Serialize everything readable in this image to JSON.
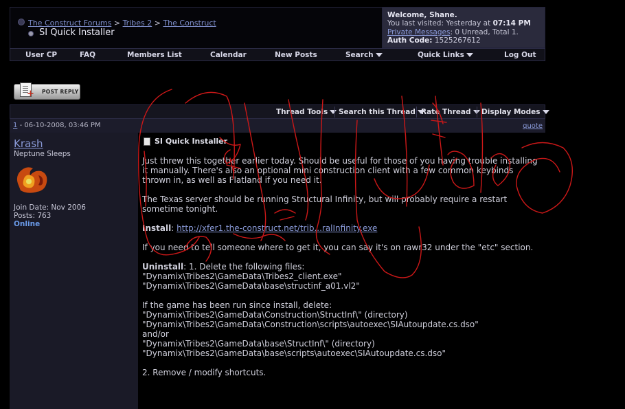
{
  "header": {
    "breadcrumb": [
      "The Construct Forums",
      "Tribes 2",
      "The Construct"
    ],
    "breadcrumb_sep": ">",
    "thread_title": "SI Quick Installer"
  },
  "welcome": {
    "greeting": "Welcome, Shane.",
    "last_visited_label": "You last visited: Yesterday at",
    "last_visited_time": "07:14 PM",
    "private_messages_link": "Private Messages",
    "private_messages_status": ": 0 Unread, Total 1.",
    "auth_code_label": "Auth Code:",
    "auth_code_value": "1525267612"
  },
  "nav": {
    "items": [
      {
        "label": "User CP",
        "dropdown": false
      },
      {
        "label": "FAQ",
        "dropdown": false
      },
      {
        "label": "Members List",
        "dropdown": false
      },
      {
        "label": "Calendar",
        "dropdown": false
      },
      {
        "label": "New Posts",
        "dropdown": false
      },
      {
        "label": "Search",
        "dropdown": true
      },
      {
        "label": "Quick Links",
        "dropdown": true
      },
      {
        "label": "Log Out",
        "dropdown": false
      }
    ]
  },
  "post_reply_label": "POST REPLY",
  "thread_tools": {
    "items": [
      {
        "label": "Thread Tools"
      },
      {
        "label": "Search this Thread"
      },
      {
        "label": "Rate Thread"
      },
      {
        "label": "Display Modes"
      }
    ]
  },
  "post": {
    "number": "1",
    "date": "- 06-10-2008, 03:46 PM",
    "quote_label": "quote",
    "author": {
      "name": "Krash",
      "title": "Neptune Sleeps",
      "join_date": "Join Date: Nov 2006",
      "posts": "Posts: 763",
      "status": "Online"
    },
    "title": "SI Quick Installer",
    "body": {
      "p1": "Just threw this together earlier today. Should be useful for those of you having trouble installing it manually. There's also an optional mini construction client with a few common keybinds thrown in, as well as Flatland if you need it.",
      "p2": "The Texas server should be running Structural Infinity, but will probably require a restart sometime tonight.",
      "install_label": "Install",
      "install_sep": ": ",
      "install_link": "http://xfer1.the-construct.net/trib...ralInfinity.exe",
      "p4": "If you need to tell someone where to get it, you can say it's on rawr32 under the \"etc\" section.",
      "uninstall_label": "Uninstall",
      "uninstall_step1": ": 1. Delete the following files:",
      "files": [
        "\"Dynamix\\Tribes2\\GameData\\Tribes2_client.exe\"",
        "\"Dynamix\\Tribes2\\GameData\\base\\structinf_a01.vl2\""
      ],
      "ran_label": "If the game has been run since install, delete:",
      "ran_files": [
        "\"Dynamix\\Tribes2\\GameData\\Construction\\StructInf\\\" (directory)",
        "\"Dynamix\\Tribes2\\GameData\\Construction\\scripts\\autoexec\\SIAutoupdate.cs.dso\"",
        "and/or",
        "\"Dynamix\\Tribes2\\GameData\\base\\StructInf\\\" (directory)",
        "\"Dynamix\\Tribes2\\GameData\\base\\scripts\\autoexec\\SIAutoupdate.cs.dso\""
      ],
      "step2": "2. Remove / modify shortcuts."
    }
  },
  "colors": {
    "background": "#000000",
    "link": "#8a9ad8",
    "user_col": "#1a1a27",
    "scribble": "#cc1818"
  }
}
